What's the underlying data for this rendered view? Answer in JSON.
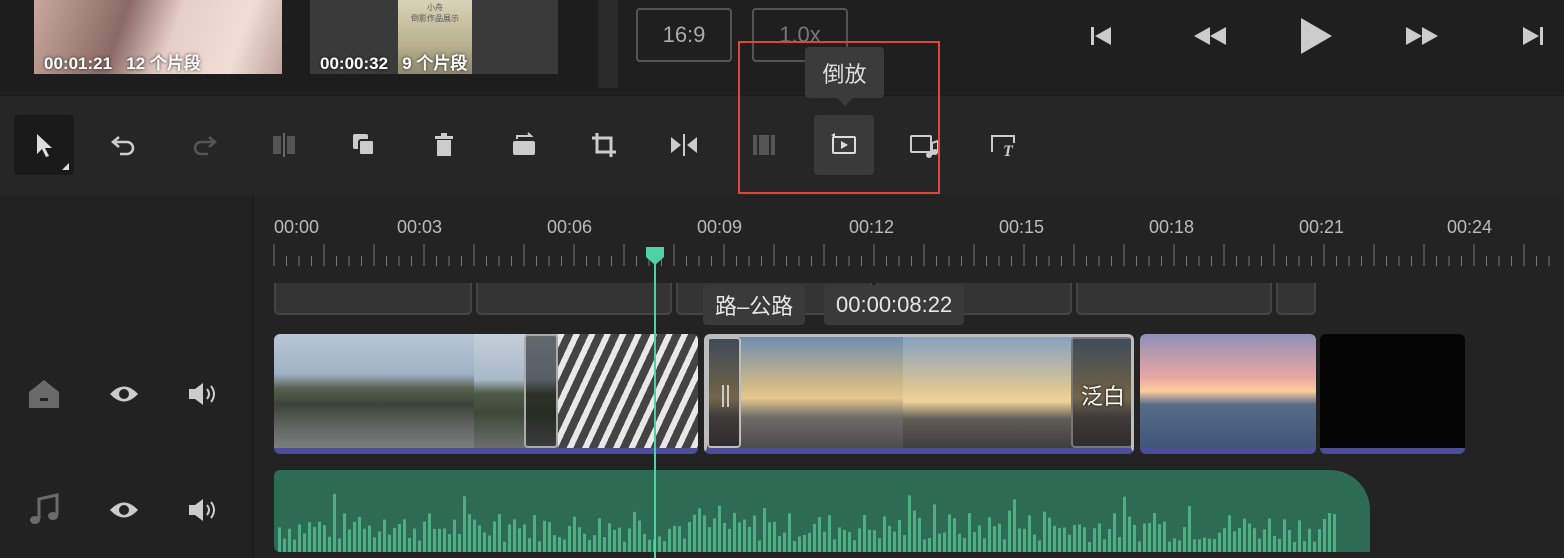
{
  "media": {
    "items": [
      {
        "duration": "00:01:21",
        "segments": "12 个片段"
      },
      {
        "duration": "00:00:32",
        "segments": "9 个片段",
        "poster_text": "小舟\n倒影作品展示"
      }
    ]
  },
  "player": {
    "aspect_ratio": "16:9",
    "speed": "1.0x",
    "controls": [
      "skip-to-start-icon",
      "rewind-icon",
      "play-icon",
      "fast-forward-icon",
      "skip-to-end-icon"
    ]
  },
  "toolbar": {
    "tools": [
      "select-icon",
      "undo-icon",
      "redo-icon",
      "split-icon",
      "copy-icon",
      "delete-icon",
      "replace-icon",
      "crop-icon",
      "mirror-icon",
      "freeze-icon",
      "reverse-icon",
      "extract-audio-icon",
      "text-icon"
    ],
    "tooltip": "倒放"
  },
  "timeline": {
    "ticks": [
      "00:00",
      "00:03",
      "00:06",
      "00:09",
      "00:12",
      "00:15",
      "00:18",
      "00:21",
      "00:24"
    ],
    "clip_title": "路–公路",
    "clip_time": "00:00:08:22",
    "clip2_overlay_text": "泛白",
    "playhead_time_seconds": 7.6
  },
  "tracks": {
    "video": {
      "icons": [
        "home-icon",
        "eye-icon",
        "speaker-icon"
      ]
    },
    "audio": {
      "icons": [
        "music-note-icon",
        "eye-icon",
        "speaker-icon"
      ]
    }
  },
  "colors": {
    "accent": "#4fd1a5",
    "highlight": "#e0453a",
    "audio_track": "#2e6b55",
    "clip_underline": "#4d4e9a"
  }
}
